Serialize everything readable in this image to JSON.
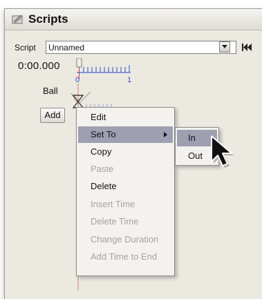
{
  "window": {
    "title": "Scripts",
    "title_icon": "scripts-icon"
  },
  "toolbar": {
    "script_label": "Script",
    "script_select": {
      "value": "Unnamed"
    },
    "rewind_icon": "rewind-to-start-icon"
  },
  "timeline": {
    "timecode": "0:00.000",
    "ruler_start": "0",
    "ruler_end": "1",
    "track_label": "Ball",
    "add_label": "Add"
  },
  "context_menu": {
    "items": [
      {
        "label": "Edit",
        "enabled": true
      },
      {
        "label": "Set To",
        "enabled": true,
        "has_submenu": true
      },
      {
        "label": "Copy",
        "enabled": true
      },
      {
        "label": "Paste",
        "enabled": false
      },
      {
        "label": "Delete",
        "enabled": true
      },
      {
        "label": "Insert Time",
        "enabled": false
      },
      {
        "label": "Delete Time",
        "enabled": false
      },
      {
        "label": "Change Duration",
        "enabled": false
      },
      {
        "label": "Add Time to End",
        "enabled": false
      }
    ]
  },
  "submenu": {
    "items": [
      {
        "label": "In"
      },
      {
        "label": "Out"
      }
    ]
  },
  "colors": {
    "menu_highlight": "#9f9fb2",
    "disabled_text": "#a3a3a3",
    "ruler_blue": "#2a4bd0"
  }
}
